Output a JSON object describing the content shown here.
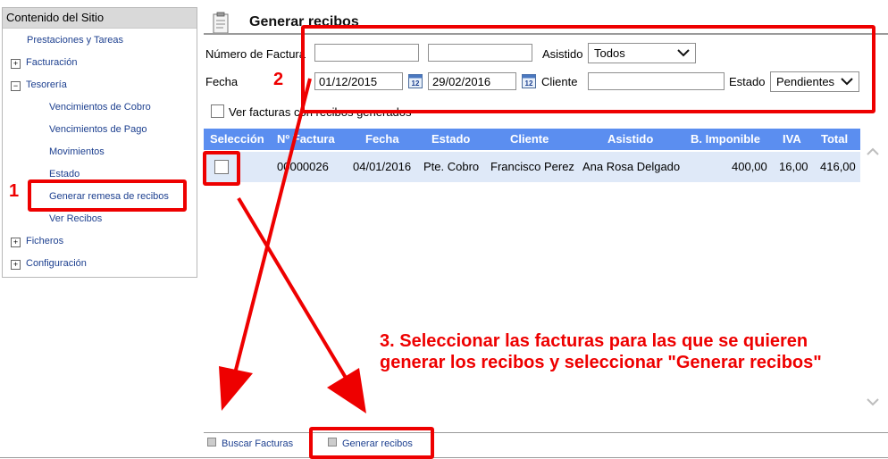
{
  "sidebar": {
    "header": "Contenido del Sitio",
    "items": [
      {
        "label": "Prestaciones y Tareas"
      },
      {
        "label": "Facturación",
        "expander": "+"
      },
      {
        "label": "Tesorería",
        "expander": "−"
      },
      {
        "label": "Vencimientos de Cobro"
      },
      {
        "label": "Vencimientos de Pago"
      },
      {
        "label": "Movimientos"
      },
      {
        "label": "Estado"
      },
      {
        "label": "Generar remesa de recibos"
      },
      {
        "label": "Ver Recibos"
      },
      {
        "label": "Ficheros",
        "expander": "+"
      },
      {
        "label": "Configuración",
        "expander": "+"
      }
    ]
  },
  "main": {
    "title": "Generar recibos"
  },
  "filters": {
    "numero_factura_label": "Número de Factura",
    "numero_factura_from": "",
    "numero_factura_to": "",
    "asistido_label": "Asistido",
    "asistido_value": "Todos",
    "fecha_label": "Fecha",
    "fecha_from": "01/12/2015",
    "fecha_to": "29/02/2016",
    "cliente_label": "Cliente",
    "cliente_value": "",
    "estado_label": "Estado",
    "estado_value": "Pendientes",
    "ver_facturas_label": "Ver facturas con recibos generados"
  },
  "table": {
    "columns": [
      "Selección",
      "Nº Factura",
      "Fecha",
      "Estado",
      "Cliente",
      "Asistido",
      "B. Imponible",
      "IVA",
      "Total"
    ],
    "rows": [
      {
        "numero": "00000026",
        "fecha": "04/01/2016",
        "estado": "Pte. Cobro",
        "cliente": "Francisco Perez",
        "asistido": "Ana Rosa Delgado",
        "base": "400,00",
        "iva": "16,00",
        "total": "416,00"
      }
    ]
  },
  "footer": {
    "buscar_label": "Buscar Facturas",
    "generar_label": "Generar recibos"
  },
  "annotations": {
    "step1": "1",
    "step2": "2",
    "step3": "3. Seleccionar las facturas para las que se quieren generar los recibos y seleccionar \"Generar recibos\""
  },
  "colors": {
    "table_header": "#5b8ef0",
    "row_highlight": "#dfe9f8",
    "annotation_red": "#ee0000",
    "link_blue": "#1c3f8f"
  },
  "icons": [
    "document-icon",
    "calendar-icon",
    "chevron-down-icon",
    "chevron-up-icon",
    "plus-icon",
    "minus-icon",
    "button-square-icon",
    "arrow-icon"
  ]
}
